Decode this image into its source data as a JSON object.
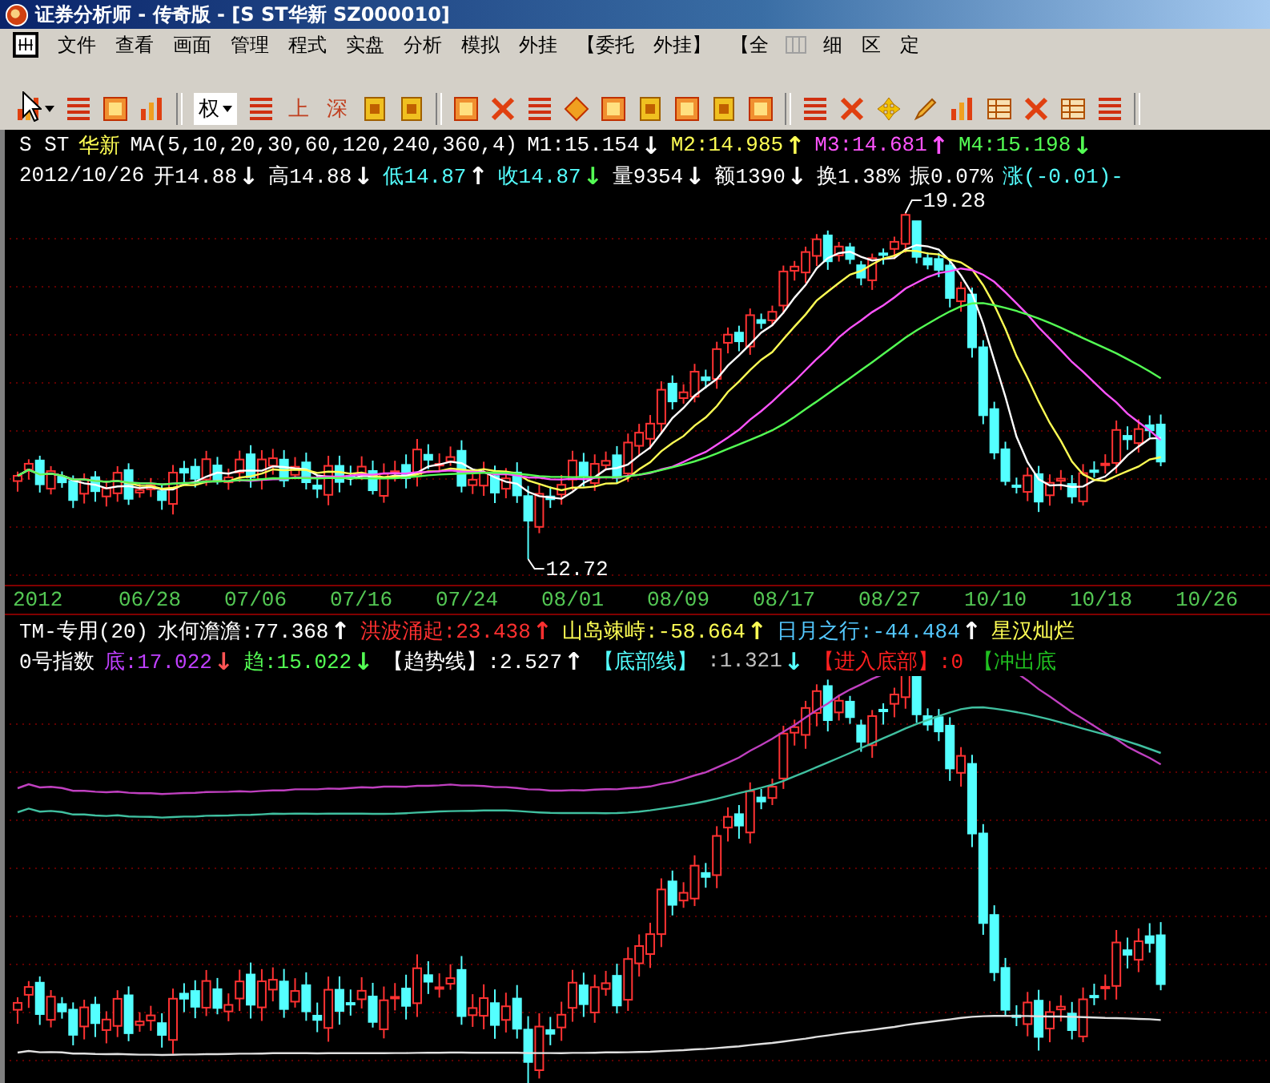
{
  "window": {
    "title": "证券分析师 - 传奇版 - [S ST华新 SZ000010]"
  },
  "menu": {
    "items": [
      "文件",
      "查看",
      "画面",
      "管理",
      "程式",
      "实盘",
      "分析",
      "模拟",
      "外挂",
      "【委托",
      "外挂】",
      "【全",
      "细",
      "区",
      "定"
    ]
  },
  "toolbar": {
    "dropdown": "权",
    "buttons": [
      "上",
      "深"
    ]
  },
  "quote": {
    "lines": [
      [
        {
          "kind": "label",
          "text": "S ST",
          "color": "#ffffff"
        },
        {
          "kind": "label",
          "text": "华新",
          "color": "#ffff54"
        },
        {
          "kind": "label",
          "text": "MA(5,10,20,30,60,120,240,360,4)",
          "color": "#ffffff"
        },
        {
          "kind": "label",
          "text": "M1:15.154",
          "color": "#ffffff"
        },
        {
          "kind": "arrow",
          "text": "↓",
          "color": "#ffffff"
        },
        {
          "kind": "label",
          "text": "M2:14.985",
          "color": "#ffff54"
        },
        {
          "kind": "arrow",
          "text": "↑",
          "color": "#ffff54"
        },
        {
          "kind": "label",
          "text": "M3:14.681",
          "color": "#ff54ff"
        },
        {
          "kind": "arrow",
          "text": "↑",
          "color": "#ff54ff"
        },
        {
          "kind": "label",
          "text": "M4:15.198",
          "color": "#54ff54"
        },
        {
          "kind": "arrow",
          "text": "↓",
          "color": "#54ff54"
        }
      ],
      [
        {
          "kind": "label",
          "text": "2012/10/26",
          "color": "#ffffff"
        },
        {
          "kind": "label",
          "text": "开14.88",
          "color": "#ffffff"
        },
        {
          "kind": "arrow",
          "text": "↓",
          "color": "#ffffff"
        },
        {
          "kind": "label",
          "text": "高14.88",
          "color": "#ffffff"
        },
        {
          "kind": "arrow",
          "text": "↓",
          "color": "#ffffff"
        },
        {
          "kind": "label",
          "text": "低14.87",
          "color": "#54ffff"
        },
        {
          "kind": "arrow",
          "text": "↑",
          "color": "#ffffff"
        },
        {
          "kind": "label",
          "text": "收14.87",
          "color": "#54ffff"
        },
        {
          "kind": "arrow",
          "text": "↓",
          "color": "#54ff54"
        },
        {
          "kind": "label",
          "text": "量9354",
          "color": "#ffffff"
        },
        {
          "kind": "arrow",
          "text": "↓",
          "color": "#ffffff"
        },
        {
          "kind": "label",
          "text": "额1390",
          "color": "#ffffff"
        },
        {
          "kind": "arrow",
          "text": "↓",
          "color": "#ffffff"
        },
        {
          "kind": "label",
          "text": "换1.38%",
          "color": "#ffffff"
        },
        {
          "kind": "label",
          "text": "振0.07%",
          "color": "#ffffff"
        },
        {
          "kind": "label",
          "text": "涨(-0.01)-",
          "color": "#54ffff"
        }
      ]
    ]
  },
  "main_chart": {
    "high_label": "19.28",
    "low_label": "12.72"
  },
  "date_axis": {
    "labels": [
      "2012",
      "06/28",
      "07/06",
      "07/16",
      "07/24",
      "08/01",
      "08/09",
      "08/17",
      "08/27",
      "10/10",
      "10/18",
      "10/26"
    ]
  },
  "indicator": {
    "lines": [
      [
        {
          "kind": "label",
          "text": "TM-专用(20)",
          "color": "#ffffff"
        },
        {
          "kind": "label",
          "text": "水何澹澹:77.368",
          "color": "#ffffff"
        },
        {
          "kind": "arrow",
          "text": "↑",
          "color": "#ffffff"
        },
        {
          "kind": "label",
          "text": "洪波涌起:23.438",
          "color": "#ff3030"
        },
        {
          "kind": "arrow",
          "text": "↑",
          "color": "#ff3030"
        },
        {
          "kind": "label",
          "text": "山岛竦峙:-58.664",
          "color": "#ffff54"
        },
        {
          "kind": "arrow",
          "text": "↑",
          "color": "#ffff54"
        },
        {
          "kind": "label",
          "text": "日月之行:-44.484",
          "color": "#54c8ff"
        },
        {
          "kind": "arrow",
          "text": "↑",
          "color": "#ffffff"
        },
        {
          "kind": "label",
          "text": "星汉灿烂",
          "color": "#ffff54"
        }
      ],
      [
        {
          "kind": "label",
          "text": "0号指数",
          "color": "#ffffff"
        },
        {
          "kind": "label",
          "text": "底:17.022",
          "color": "#c040ff"
        },
        {
          "kind": "arrow",
          "text": "↓",
          "color": "#ff5454"
        },
        {
          "kind": "label",
          "text": "趋:15.022",
          "color": "#54ff54"
        },
        {
          "kind": "arrow",
          "text": "↓",
          "color": "#54ff54"
        },
        {
          "kind": "label",
          "text": "【趋势线】:2.527",
          "color": "#ffffff"
        },
        {
          "kind": "arrow",
          "text": "↑",
          "color": "#ffffff"
        },
        {
          "kind": "label",
          "text": "【底部线】",
          "color": "#54ffff"
        },
        {
          "kind": "label",
          "text": ":1.321",
          "color": "#c0c0c0"
        },
        {
          "kind": "arrow",
          "text": "↓",
          "color": "#54ffff"
        },
        {
          "kind": "label",
          "text": "【进入底部】:0",
          "color": "#ff2020"
        },
        {
          "kind": "label",
          "text": "【冲出底",
          "color": "#20c020"
        }
      ]
    ]
  }
}
